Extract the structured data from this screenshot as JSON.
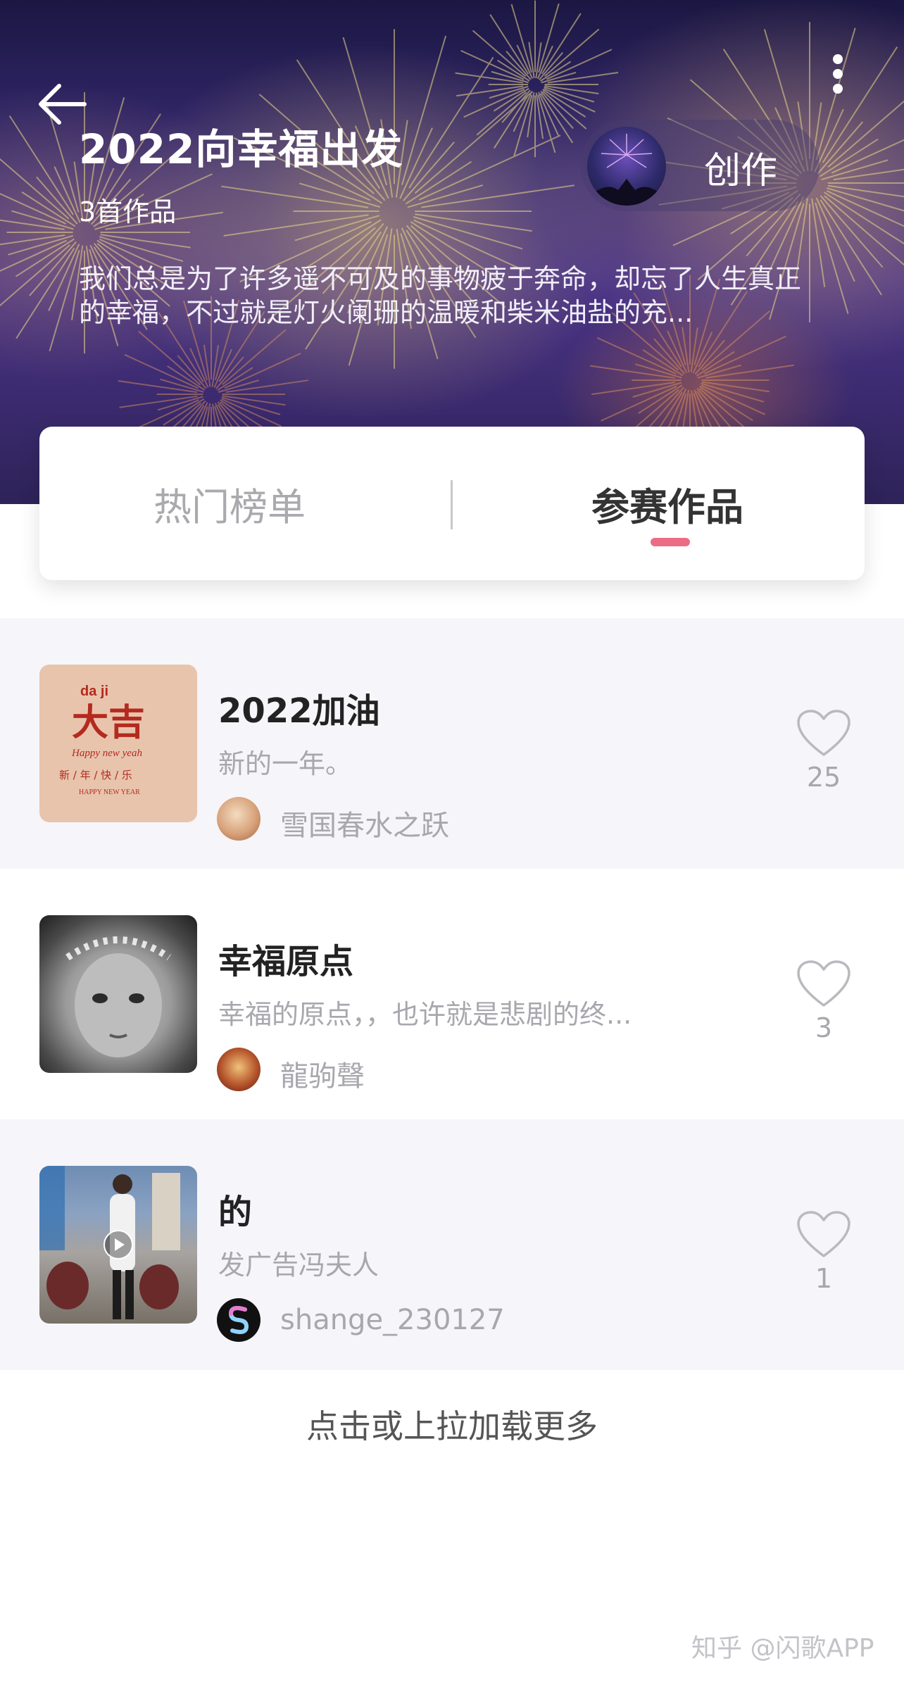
{
  "header": {
    "title": "2022向幸福出发",
    "works_count": "3首作品",
    "description": "我们总是为了许多遥不可及的事物疲于奔命，却忘了人生真正的幸福，不过就是灯火阑珊的温暖和柴米油盐的充...",
    "create_button_label": "创作",
    "back_icon": "arrow-left-icon",
    "more_icon": "vertical-dots-icon"
  },
  "tabs": [
    {
      "label": "热门榜单",
      "active": false
    },
    {
      "label": "参赛作品",
      "active": true
    }
  ],
  "accent_color": "#ea6d85",
  "entries": [
    {
      "title": "2022加油",
      "subtitle": "新的一年。",
      "author": "雪国春水之跃",
      "likes": "25",
      "thumb": {
        "line1": "da   ji",
        "big": "大吉",
        "line2": "Happy new yeah",
        "line3": "新 / 年 / 快 / 乐",
        "line4": "HAPPY NEW YEAR"
      }
    },
    {
      "title": "幸福原点",
      "subtitle": "幸福的原点，，也许就是悲剧的终...",
      "author": "龍驹聲",
      "likes": "3"
    },
    {
      "title": "的",
      "subtitle": "发广告冯夫人",
      "author": "shange_230127",
      "likes": "1"
    }
  ],
  "load_more": "点击或上拉加载更多",
  "watermark": "知乎 @闪歌APP"
}
